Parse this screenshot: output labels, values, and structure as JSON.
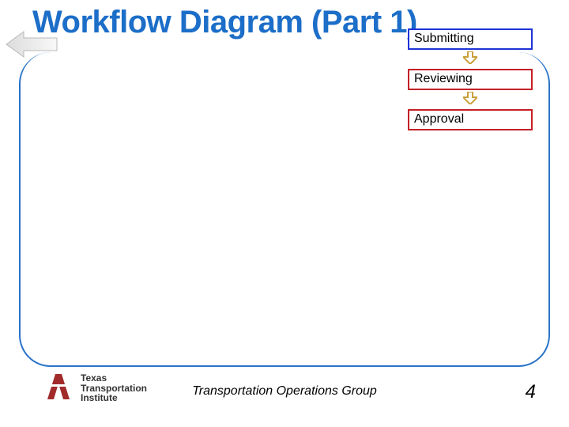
{
  "title": "Workflow Diagram (Part 1)",
  "flow": {
    "steps": [
      {
        "label": "Submitting",
        "active": true
      },
      {
        "label": "Reviewing",
        "active": false
      },
      {
        "label": "Approval",
        "active": false
      }
    ]
  },
  "logo": {
    "line1": "Texas",
    "line2": "Transportation",
    "line3": "Institute"
  },
  "footer": "Transportation Operations Group",
  "page": "4"
}
